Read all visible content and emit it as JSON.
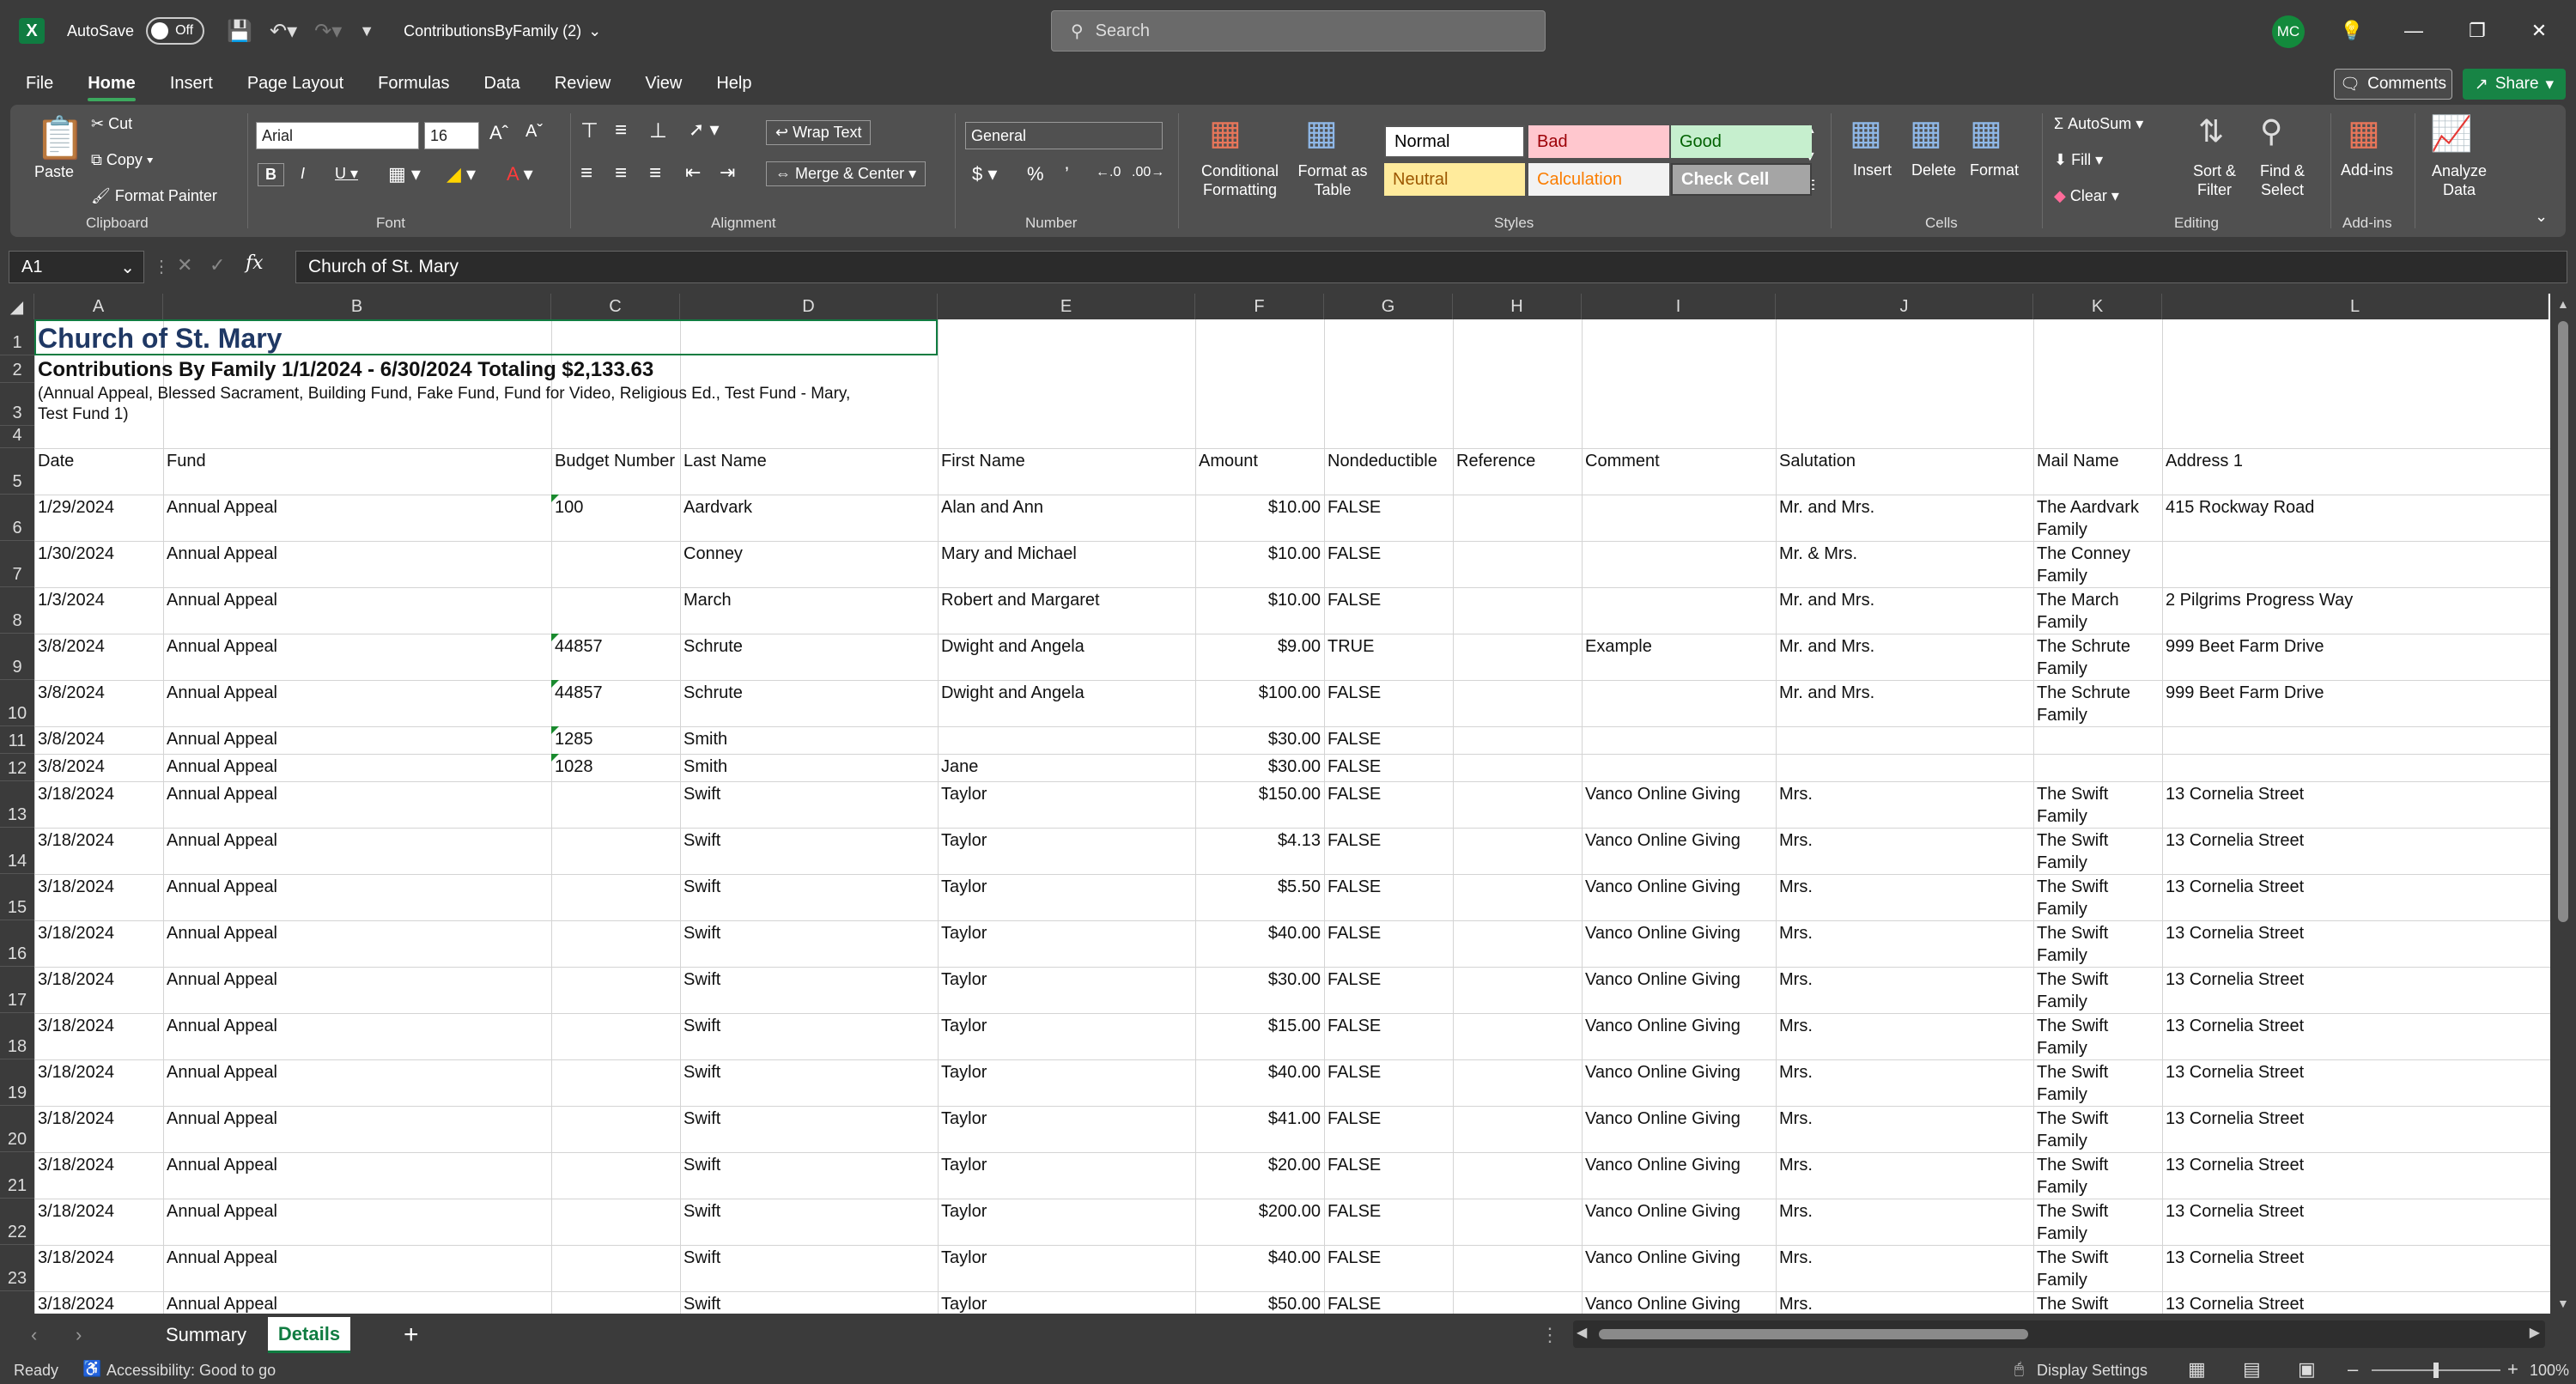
{
  "titlebar": {
    "autosave_label": "AutoSave",
    "autosave_state": "Off",
    "filename": "ContributionsByFamily (2)",
    "search_placeholder": "Search",
    "avatar_initials": "MC"
  },
  "menu": [
    "File",
    "Home",
    "Insert",
    "Page Layout",
    "Formulas",
    "Data",
    "Review",
    "View",
    "Help"
  ],
  "buttons": {
    "comments": "Comments",
    "share": "Share"
  },
  "ribbon": {
    "clipboard": {
      "paste": "Paste",
      "cut": "Cut",
      "copy": "Copy",
      "format_painter": "Format Painter",
      "label": "Clipboard"
    },
    "font": {
      "name": "Arial",
      "size": "16",
      "label": "Font"
    },
    "alignment": {
      "wrap_text": "Wrap Text",
      "merge_center": "Merge & Center",
      "label": "Alignment"
    },
    "number": {
      "format": "General",
      "label": "Number"
    },
    "styles": {
      "conditional": "Conditional Formatting",
      "format_table": "Format as Table",
      "label": "Styles",
      "cells": [
        {
          "text": "Normal",
          "bg": "#ffffff",
          "fg": "#000000"
        },
        {
          "text": "Bad",
          "bg": "#ffc7ce",
          "fg": "#9c0006"
        },
        {
          "text": "Good",
          "bg": "#c6efce",
          "fg": "#006100"
        },
        {
          "text": "Neutral",
          "bg": "#ffeb9c",
          "fg": "#9c5700"
        },
        {
          "text": "Calculation",
          "bg": "#f2f2f2",
          "fg": "#fa7d00"
        },
        {
          "text": "Check Cell",
          "bg": "#a5a5a5",
          "fg": "#ffffff"
        }
      ]
    },
    "cells": {
      "insert": "Insert",
      "delete": "Delete",
      "format": "Format",
      "label": "Cells"
    },
    "editing": {
      "autosum": "AutoSum",
      "fill": "Fill",
      "clear": "Clear",
      "sort_filter": "Sort & Filter",
      "find_select": "Find & Select",
      "label": "Editing"
    },
    "addins": {
      "addins": "Add-ins",
      "label": "Add-ins"
    },
    "analyze": {
      "label": "Analyze Data"
    }
  },
  "formula_bar": {
    "name_box": "A1",
    "content": "Church of St. Mary"
  },
  "columns": [
    "A",
    "B",
    "C",
    "D",
    "E",
    "F",
    "G",
    "H",
    "I",
    "J",
    "K",
    "L"
  ],
  "sheet": {
    "title": "Church of St. Mary",
    "subtitle": "Contributions By Family 1/1/2024 - 6/30/2024 Totaling $2,133.63",
    "funds_line1": "(Annual Appeal, Blessed Sacrament, Building Fund, Fake Fund, Fund for Video, Religious Ed., Test Fund - Mary,",
    "funds_line2": "Test Fund 1)",
    "headers": [
      "Date",
      "Fund",
      "Budget Number",
      "Last Name",
      "First Name",
      "Amount",
      "Nondeductible",
      "Reference",
      "Comment",
      "Salutation",
      "Mail Name",
      "Address 1"
    ],
    "rows": [
      [
        "1/29/2024",
        "Annual Appeal",
        "100",
        "Aardvark",
        "Alan and Ann",
        "$10.00",
        "FALSE",
        "",
        "",
        "Mr. and Mrs.",
        "The Aardvark Family",
        "415 Rockway Road"
      ],
      [
        "1/30/2024",
        "Annual Appeal",
        "",
        "Conney",
        "Mary and Michael",
        "$10.00",
        "FALSE",
        "",
        "",
        "Mr. & Mrs.",
        "The Conney Family",
        ""
      ],
      [
        "1/3/2024",
        "Annual Appeal",
        "",
        "March",
        "Robert and Margaret",
        "$10.00",
        "FALSE",
        "",
        "",
        "Mr. and Mrs.",
        "The March Family",
        "2 Pilgrims Progress Way"
      ],
      [
        "3/8/2024",
        "Annual Appeal",
        "44857",
        "Schrute",
        "Dwight and Angela",
        "$9.00",
        "TRUE",
        "",
        "Example",
        "Mr. and Mrs.",
        "The Schrute Family",
        "999 Beet Farm Drive"
      ],
      [
        "3/8/2024",
        "Annual Appeal",
        "44857",
        "Schrute",
        "Dwight and Angela",
        "$100.00",
        "FALSE",
        "",
        "",
        "Mr. and Mrs.",
        "The Schrute Family",
        "999 Beet Farm Drive"
      ],
      [
        "3/8/2024",
        "Annual Appeal",
        "1285",
        "Smith",
        "",
        "$30.00",
        "FALSE",
        "",
        "",
        "",
        "",
        ""
      ],
      [
        "3/8/2024",
        "Annual Appeal",
        "1028",
        "Smith",
        "Jane",
        "$30.00",
        "FALSE",
        "",
        "",
        "",
        "",
        ""
      ],
      [
        "3/18/2024",
        "Annual Appeal",
        "",
        "Swift",
        "Taylor",
        "$150.00",
        "FALSE",
        "",
        "Vanco Online Giving",
        "Mrs.",
        "The Swift Family",
        "13 Cornelia Street"
      ],
      [
        "3/18/2024",
        "Annual Appeal",
        "",
        "Swift",
        "Taylor",
        "$4.13",
        "FALSE",
        "",
        "Vanco Online Giving",
        "Mrs.",
        "The Swift Family",
        "13 Cornelia Street"
      ],
      [
        "3/18/2024",
        "Annual Appeal",
        "",
        "Swift",
        "Taylor",
        "$5.50",
        "FALSE",
        "",
        "Vanco Online Giving",
        "Mrs.",
        "The Swift Family",
        "13 Cornelia Street"
      ],
      [
        "3/18/2024",
        "Annual Appeal",
        "",
        "Swift",
        "Taylor",
        "$40.00",
        "FALSE",
        "",
        "Vanco Online Giving",
        "Mrs.",
        "The Swift Family",
        "13 Cornelia Street"
      ],
      [
        "3/18/2024",
        "Annual Appeal",
        "",
        "Swift",
        "Taylor",
        "$30.00",
        "FALSE",
        "",
        "Vanco Online Giving",
        "Mrs.",
        "The Swift Family",
        "13 Cornelia Street"
      ],
      [
        "3/18/2024",
        "Annual Appeal",
        "",
        "Swift",
        "Taylor",
        "$15.00",
        "FALSE",
        "",
        "Vanco Online Giving",
        "Mrs.",
        "The Swift Family",
        "13 Cornelia Street"
      ],
      [
        "3/18/2024",
        "Annual Appeal",
        "",
        "Swift",
        "Taylor",
        "$40.00",
        "FALSE",
        "",
        "Vanco Online Giving",
        "Mrs.",
        "The Swift Family",
        "13 Cornelia Street"
      ],
      [
        "3/18/2024",
        "Annual Appeal",
        "",
        "Swift",
        "Taylor",
        "$41.00",
        "FALSE",
        "",
        "Vanco Online Giving",
        "Mrs.",
        "The Swift Family",
        "13 Cornelia Street"
      ],
      [
        "3/18/2024",
        "Annual Appeal",
        "",
        "Swift",
        "Taylor",
        "$20.00",
        "FALSE",
        "",
        "Vanco Online Giving",
        "Mrs.",
        "The Swift Family",
        "13 Cornelia Street"
      ],
      [
        "3/18/2024",
        "Annual Appeal",
        "",
        "Swift",
        "Taylor",
        "$200.00",
        "FALSE",
        "",
        "Vanco Online Giving",
        "Mrs.",
        "The Swift Family",
        "13 Cornelia Street"
      ],
      [
        "3/18/2024",
        "Annual Appeal",
        "",
        "Swift",
        "Taylor",
        "$40.00",
        "FALSE",
        "",
        "Vanco Online Giving",
        "Mrs.",
        "The Swift Family",
        "13 Cornelia Street"
      ],
      [
        "3/18/2024",
        "Annual Appeal",
        "",
        "Swift",
        "Taylor",
        "$50.00",
        "FALSE",
        "",
        "Vanco Online Giving",
        "Mrs.",
        "The Swift Family",
        "13 Cornelia Street"
      ]
    ]
  },
  "tabs": [
    {
      "label": "Summary"
    },
    {
      "label": "Details"
    }
  ],
  "status": {
    "ready": "Ready",
    "accessibility": "Accessibility: Good to go",
    "display_settings": "Display Settings",
    "zoom": "100%"
  }
}
